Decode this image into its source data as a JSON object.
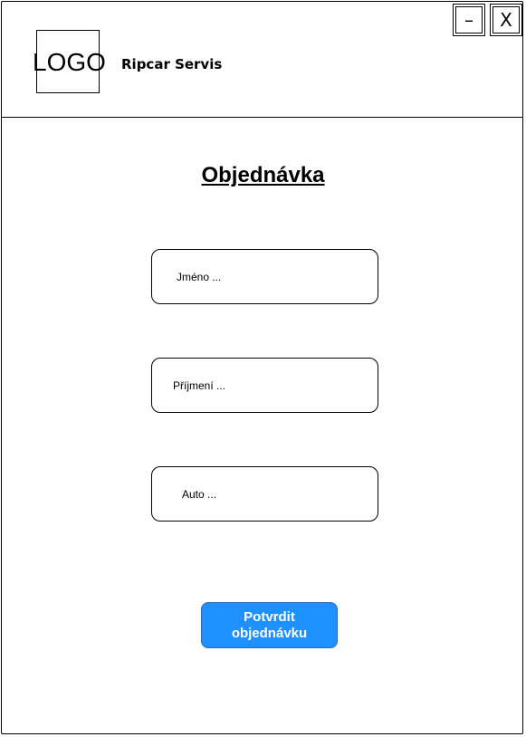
{
  "header": {
    "logo_text": "LOGO",
    "app_name": "Ripcar Servis",
    "minimize_label": "–",
    "close_label": "X"
  },
  "main": {
    "title": "Objednávka",
    "fields": [
      {
        "placeholder": "Jméno ..."
      },
      {
        "placeholder": "Příjmení ..."
      },
      {
        "placeholder": "Auto ..."
      }
    ],
    "submit_label": "Potvrdit objednávku"
  },
  "colors": {
    "accent": "#1e90ff",
    "background": "#ffffff",
    "border": "#000000"
  }
}
